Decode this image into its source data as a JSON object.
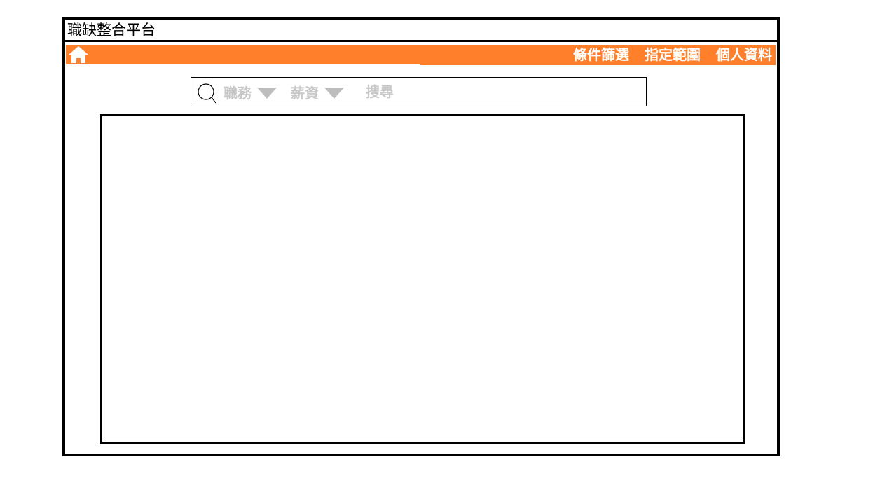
{
  "app": {
    "title": "職缺整合平台"
  },
  "nav": {
    "home_icon": "home-icon",
    "items": [
      {
        "label": "條件篩選"
      },
      {
        "label": "指定範圍"
      },
      {
        "label": "個人資料"
      }
    ]
  },
  "search": {
    "icon": "search-icon",
    "job_filter": {
      "label": "職務"
    },
    "salary_filter": {
      "label": "薪資"
    },
    "submit_label": "搜尋"
  },
  "colors": {
    "accent": "#ff7f2a",
    "placeholder_text": "#c8c8c8",
    "border": "#000000"
  }
}
